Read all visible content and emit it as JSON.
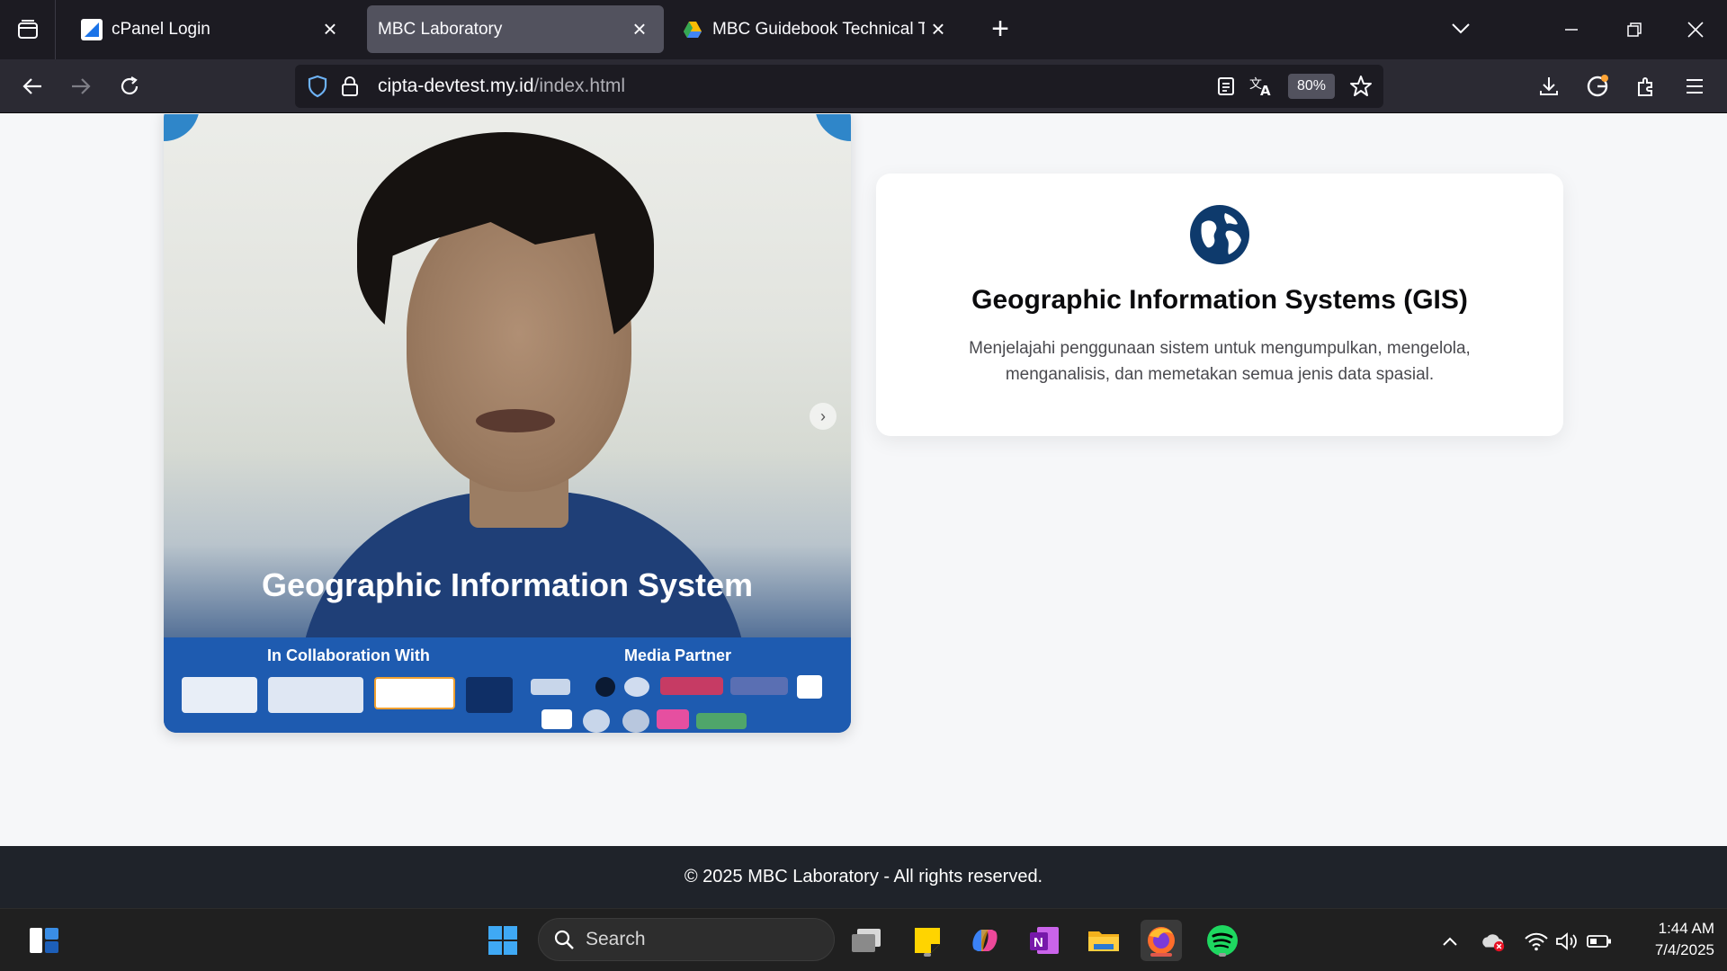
{
  "browser": {
    "tabs": [
      {
        "title": "cPanel Login",
        "favicon_color": "#1a73e8",
        "active": false
      },
      {
        "title": "MBC Laboratory",
        "favicon_color": "",
        "active": true
      },
      {
        "title": "MBC Guidebook Technical Test ...",
        "favicon_color": "#34a853",
        "active": false
      }
    ],
    "url": {
      "host": "cipta-devtest.my.id",
      "path": "/index.html"
    },
    "zoom": "80%"
  },
  "video": {
    "caption": "Geographic Information System",
    "collab_label": "In Collaboration With",
    "media_label": "Media Partner",
    "next_glyph": "›"
  },
  "info_card": {
    "icon": "globe-icon",
    "title": "Geographic Information Systems (GIS)",
    "description": "Menjelajahi penggunaan sistem untuk mengumpulkan, mengelola, menganalisis, dan memetakan semua jenis data spasial."
  },
  "footer": {
    "text": "© 2025 MBC Laboratory - All rights reserved."
  },
  "taskbar": {
    "search_label": "Search",
    "clock": {
      "time": "1:44 AM",
      "date": "7/4/2025"
    }
  },
  "colors": {
    "accent_navy": "#0e3a6c",
    "band_blue": "#1e5bb0",
    "footer_bg": "#1f232a"
  }
}
